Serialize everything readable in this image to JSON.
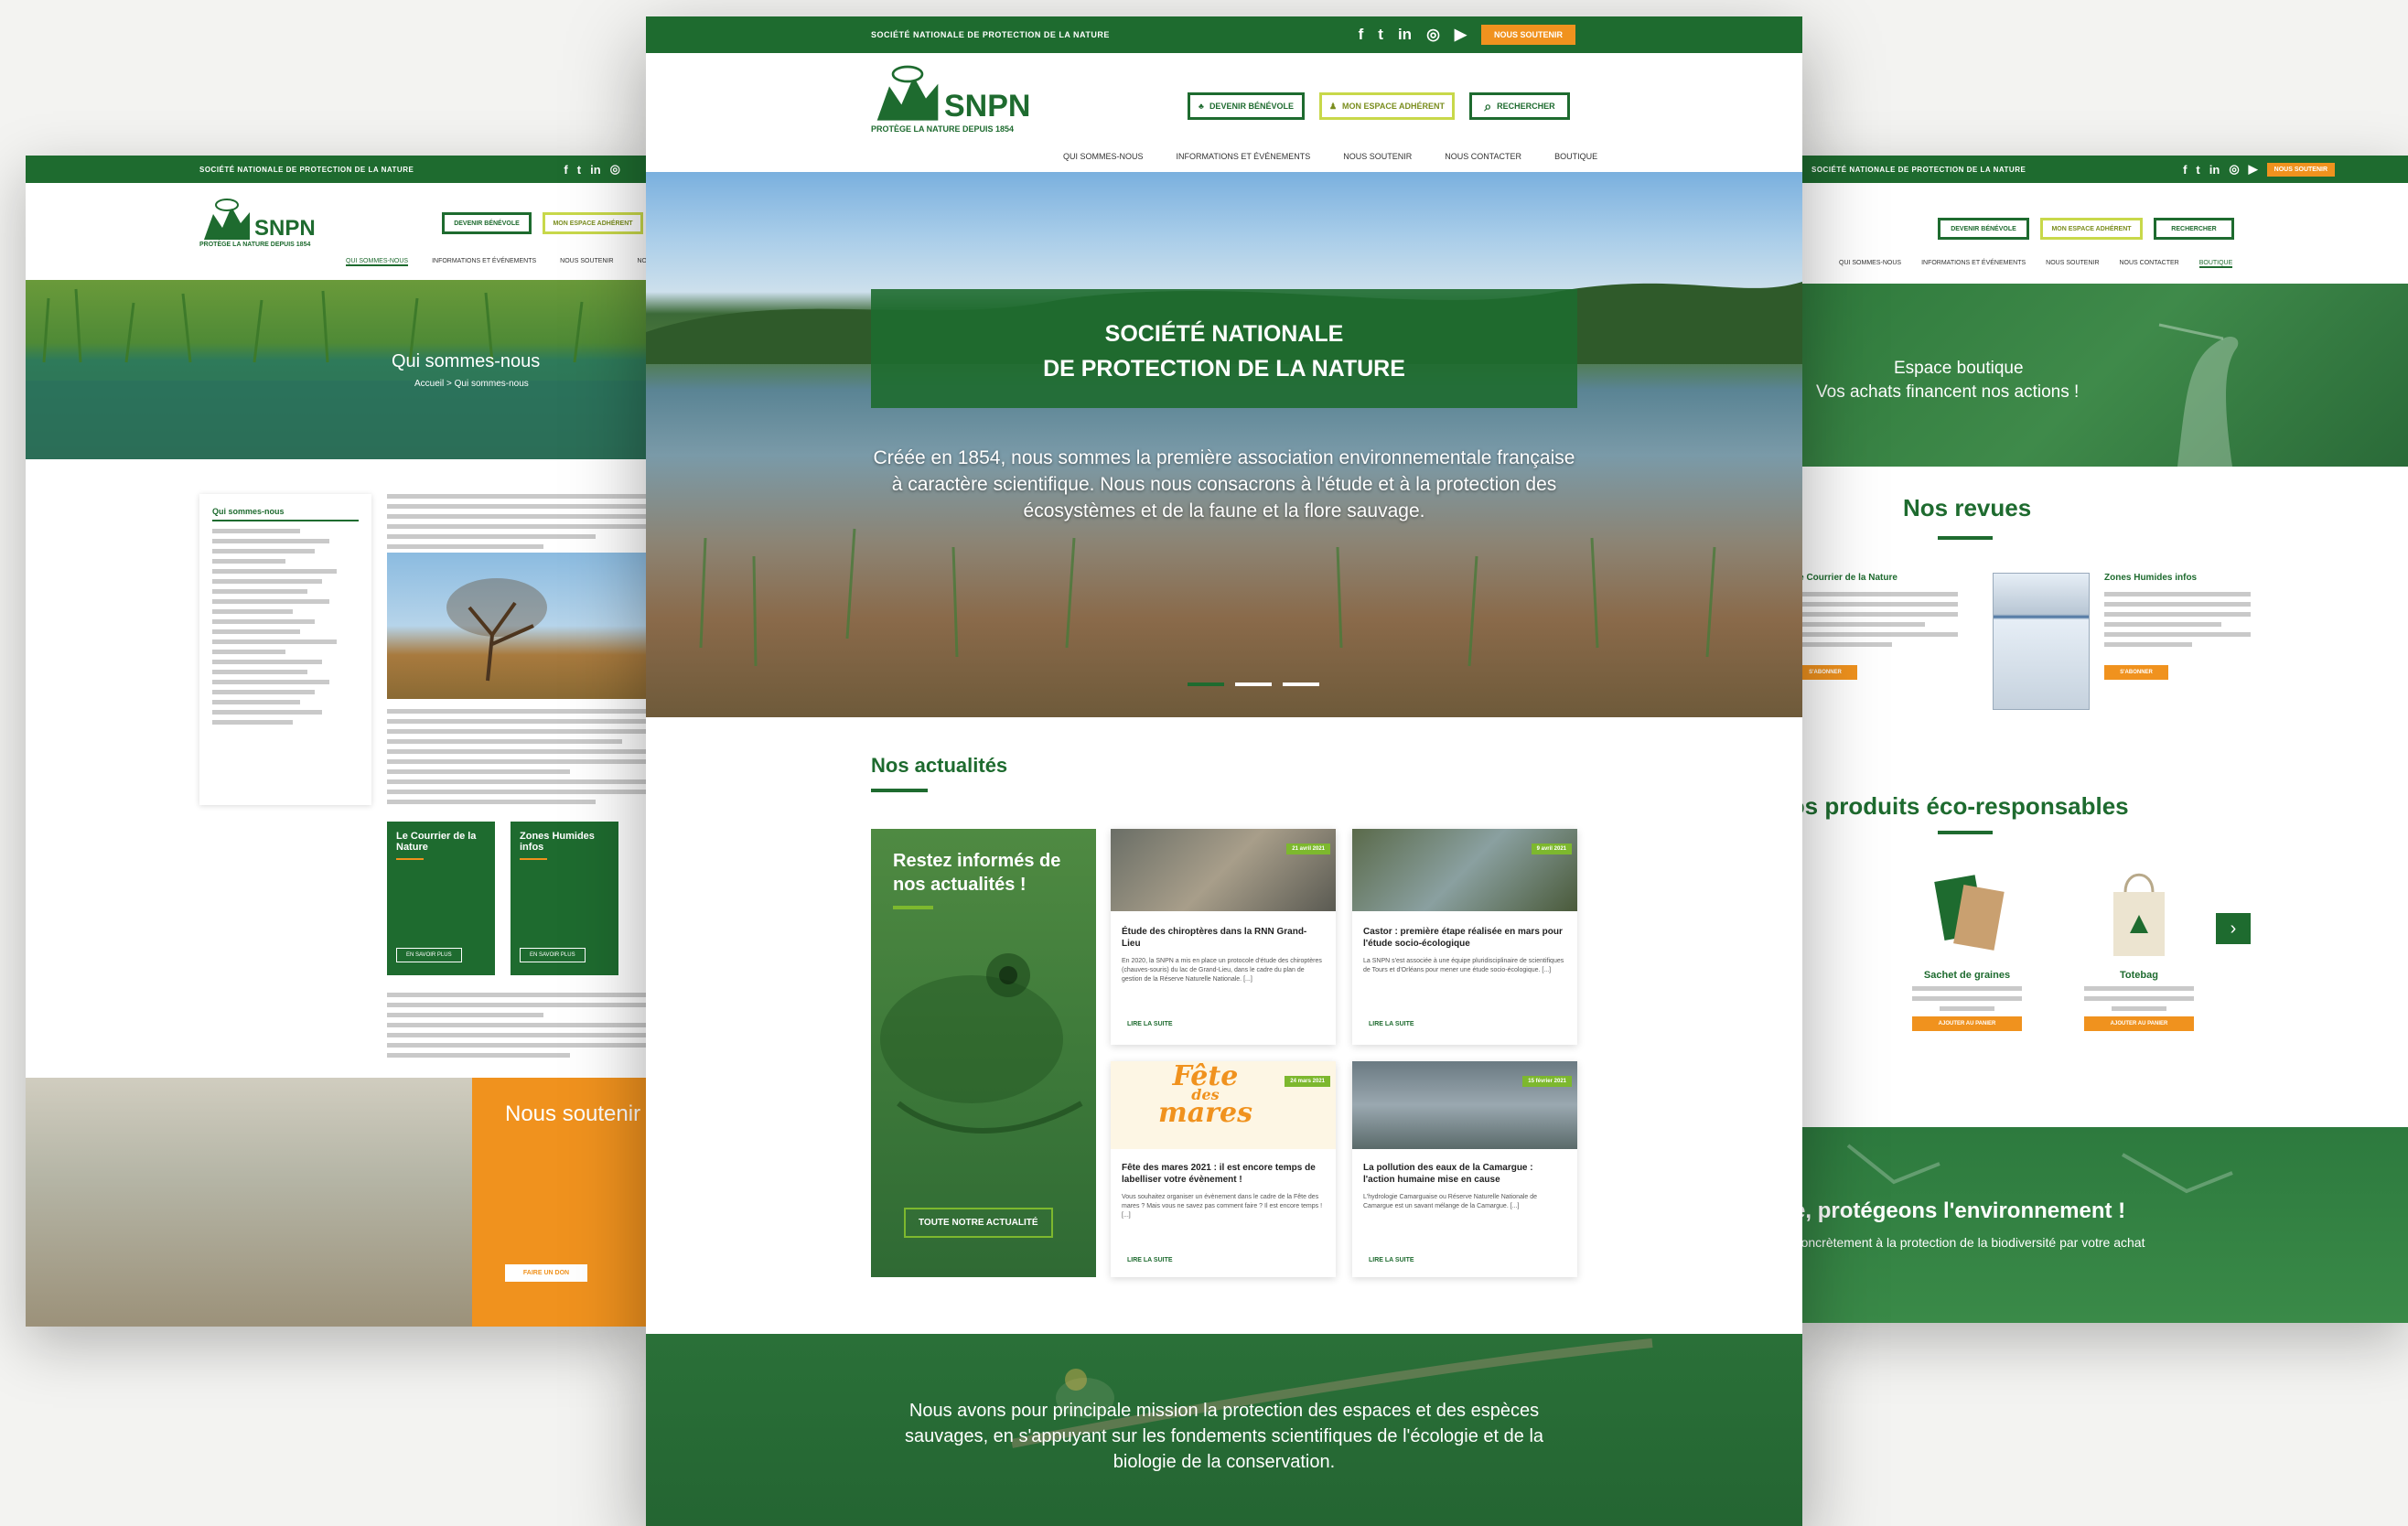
{
  "org_short": "SOCIÉTÉ NATIONALE DE PROTECTION DE LA NATURE",
  "support_label": "NOUS SOUTENIR",
  "logo": {
    "name": "SNPN",
    "tagline": "PROTÈGE LA NATURE DEPUIS 1854"
  },
  "header_buttons": {
    "volunteer": "DEVENIR BÉNÉVOLE",
    "space": "MON ESPACE ADHÉRENT",
    "search": "RECHERCHER"
  },
  "nav": [
    "QUI SOMMES-NOUS",
    "INFORMATIONS ET ÉVÉNEMENTS",
    "NOUS SOUTENIR",
    "NOUS CONTACTER",
    "BOUTIQUE"
  ],
  "center": {
    "hero_title_1": "SOCIÉTÉ NATIONALE",
    "hero_title_2": "DE PROTECTION DE LA NATURE",
    "hero_text": "Créée en 1854, nous sommes la première association environnementale française à caractère scientifique. Nous nous consacrons à l'étude et à la protection des écosystèmes et de la faune et la flore sauvage.",
    "news_title": "Nos actualités",
    "promo_title": "Restez informés de nos actualités !",
    "promo_button": "TOUTE NOTRE ACTUALITÉ",
    "read_more": "LIRE LA SUITE",
    "news": [
      {
        "date": "21 avril 2021",
        "title": "Étude des chiroptères dans la RNN Grand-Lieu",
        "text": "En 2020, la SNPN a mis en place un protocole d'étude des chiroptères (chauves-souris) du lac de Grand-Lieu, dans le cadre du plan de gestion de la Réserve Naturelle Nationale. [...]"
      },
      {
        "date": "9 avril 2021",
        "title": "Castor : première étape réalisée en mars pour l'étude socio-écologique",
        "text": "La SNPN s'est associée à une équipe pluridisciplinaire de scientifiques de Tours et d'Orléans pour mener une étude socio-écologique. [...]"
      },
      {
        "date": "24 mars 2021",
        "title": "Fête des mares 2021 : il est encore temps de labelliser votre évènement !",
        "text": "Vous souhaitez organiser un évènement dans le cadre de la Fête des mares ? Mais vous ne savez pas comment faire ? Il est encore temps ! [...]"
      },
      {
        "date": "15 février 2021",
        "title": "La pollution des eaux de la Camargue : l'action humaine mise en cause",
        "text": "L'hydrologie Camarguaise ou Réserve Naturelle Nationale de Camargue est un savant mélange de la Camargue. [...]"
      }
    ],
    "fete_text_1": "Fête",
    "fete_text_2": "des",
    "fete_text_3": "mares",
    "mission_text": "Nous avons pour principale mission la protection des espaces et des espèces sauvages, en s'appuyant sur les fondements scientifiques de l'écologie et de la biologie de la conservation."
  },
  "left": {
    "hero_title": "Qui sommes-nous",
    "breadcrumb": "Accueil > Qui sommes-nous",
    "sidebar_title": "Qui sommes-nous",
    "card1": "Le Courrier de la Nature",
    "card2": "Zones Humides infos",
    "card_btn": "EN SAVOIR PLUS",
    "support_title": "Nous soutenir",
    "support_btn": "FAIRE UN DON"
  },
  "right": {
    "hero_line1": "Espace boutique",
    "hero_line2": "Vos achats financent nos actions !",
    "reviews_title": "Nos revues",
    "review1": "Le Courrier de la Nature",
    "review2": "Zones Humides infos",
    "review_btn": "S'ABONNER",
    "products_title": "Nos produits éco-responsables",
    "product1": "Sachet de graines",
    "product2": "Totebag",
    "product_btn": "AJOUTER AU PANIER",
    "banner_title": "Ensemble, protégeons l'environnement !",
    "banner_text": "Contribuez concrètement à la protection de la biodiversité par votre achat"
  },
  "colors": {
    "brand_green": "#1e6b2f",
    "accent_orange": "#f0921e",
    "light_green": "#7db82e"
  }
}
